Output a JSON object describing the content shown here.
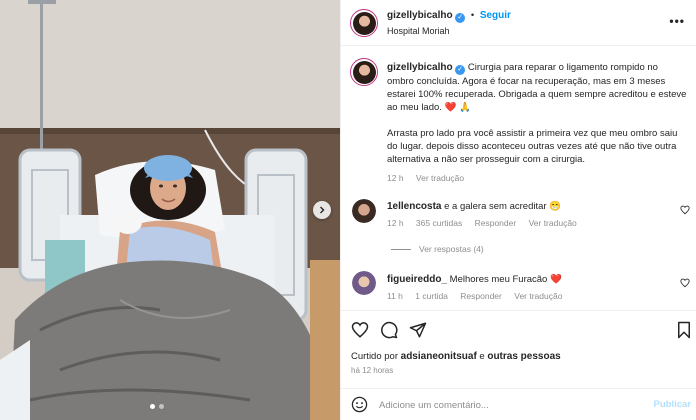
{
  "post": {
    "author": "gizellybicalho",
    "follow_label": "Seguir",
    "location": "Hospital Moriah",
    "more_label": "•••"
  },
  "caption": {
    "username": "gizellybicalho",
    "paragraph1": "Cirurgia para reparar o ligamento rompido no ombro concluída. Agora é focar na recuperação, mas em 3 meses estarei 100% recuperada. Obrigada a quem sempre acreditou e esteve ao meu lado. ❤️ 🙏",
    "paragraph2": "Arrasta pro lado pra você assistir a primeira vez que meu ombro saiu do lugar. depois disso aconteceu outras vezes até que não tive outra alternativa a não ser prosseguir com a cirurgia.",
    "time": "12 h",
    "translate": "Ver tradução"
  },
  "comments": [
    {
      "username": "1ellencosta",
      "text": "e a galera sem acreditar 😁",
      "time": "12 h",
      "likes": "365 curtidas",
      "reply": "Responder",
      "translate": "Ver tradução"
    },
    {
      "username": "figueireddo_",
      "text": "Melhores meu Furacão ❤️",
      "time": "11 h",
      "likes": "1 curtida",
      "reply": "Responder",
      "translate": "Ver tradução"
    }
  ],
  "view_replies": "Ver respostas (4)",
  "liked_by": {
    "prefix": "Curtido por ",
    "user": "adsianeonitsuaf",
    "middle": " e ",
    "others": "outras pessoas"
  },
  "posted_ago": "há 12 horas",
  "add_comment": {
    "placeholder": "Adicione um comentário...",
    "publish": "Publicar"
  },
  "icons": {
    "like": "heart-icon",
    "comment": "comment-icon",
    "share": "share-icon",
    "save": "bookmark-icon",
    "emoji": "emoji-icon",
    "next": "chevron-right-icon",
    "verified": "verified-badge-icon"
  },
  "colors": {
    "accent": "#0095f6",
    "verified": "#3897f0",
    "muted": "#8e8e8e",
    "text": "#262626"
  }
}
